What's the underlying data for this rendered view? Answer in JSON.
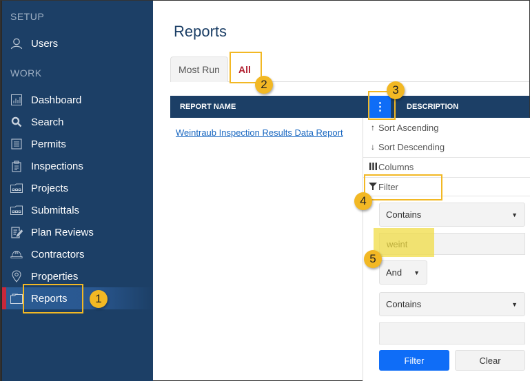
{
  "sidebar": {
    "sections": [
      {
        "label": "SETUP"
      },
      {
        "label": "WORK"
      }
    ],
    "items": [
      {
        "label": "Users",
        "icon": "user-icon"
      },
      {
        "label": "Dashboard",
        "icon": "chart-icon"
      },
      {
        "label": "Search",
        "icon": "search-icon"
      },
      {
        "label": "Permits",
        "icon": "document-icon"
      },
      {
        "label": "Inspections",
        "icon": "clipboard-icon"
      },
      {
        "label": "Projects",
        "icon": "folder-icon"
      },
      {
        "label": "Submittals",
        "icon": "folder-icon"
      },
      {
        "label": "Plan Reviews",
        "icon": "edit-document-icon"
      },
      {
        "label": "Contractors",
        "icon": "hard-hat-icon"
      },
      {
        "label": "Properties",
        "icon": "map-pin-icon"
      },
      {
        "label": "Reports",
        "icon": "folder-open-icon",
        "active": true
      }
    ]
  },
  "main": {
    "title": "Reports",
    "tabs": [
      {
        "label": "Most Run"
      },
      {
        "label": "All",
        "active": true
      }
    ],
    "grid": {
      "columns": [
        "REPORT NAME",
        "DESCRIPTION"
      ],
      "rows": [
        {
          "report_name": "Weintraub Inspection Results Data Report",
          "description": ""
        }
      ]
    },
    "column_menu": {
      "menu_icon": "⋮",
      "items": [
        {
          "label": "Sort Ascending",
          "icon": "↑"
        },
        {
          "label": "Sort Descending",
          "icon": "↓"
        },
        {
          "label": "Columns",
          "icon": "|||"
        },
        {
          "label": "Filter",
          "icon": "▼"
        }
      ],
      "filter": {
        "operator1": "Contains",
        "value1": "weint",
        "logic": "And",
        "operator2": "Contains",
        "value2": "",
        "filter_button": "Filter",
        "clear_button": "Clear"
      }
    }
  },
  "callouts": [
    "1",
    "2",
    "3",
    "4",
    "5"
  ],
  "colors": {
    "sidebar_bg": "#1c3f66",
    "accent_blue": "#0f6df7",
    "active_tab": "#b01e2e",
    "highlight": "#f2b824"
  }
}
